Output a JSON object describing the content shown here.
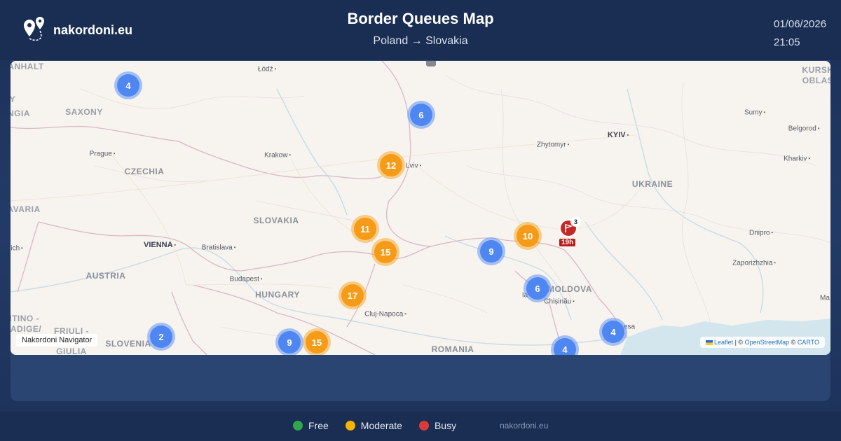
{
  "brand": {
    "name": "nakordoni.eu",
    "logo_icon": "map-pin-route-icon"
  },
  "header": {
    "title": "Border Queues Map",
    "subtitle": "Poland → Slovakia",
    "date": "01/06/2026",
    "time": "21:05"
  },
  "map": {
    "labels": {
      "anhalt": "ANHALT",
      "saxony": "SAXONY",
      "czechia": "CZECHIA",
      "slovakia": "SLOVAKIA",
      "austria": "AUSTRIA",
      "hungary": "HUNGARY",
      "slovenia": "SLOVENIA",
      "romania": "ROMANIA",
      "ukraine": "UKRAINE",
      "moldova": "MOLDOVA",
      "kursk": "KURSK",
      "oblas": "OBLAS",
      "avaria": "AVARIA",
      "ngia": "NGIA",
      "y": "Y",
      "ntino": "NTINO -",
      "adige": "ADIGE/",
      "friuli": "FRIULI -",
      "giulia": "GIULIA",
      "lodz": "Łódź",
      "prague": "Prague",
      "krakow": "Krakow",
      "lviv": "Lviv",
      "vienna": "VIENNA",
      "bratislava": "Bratislava",
      "budapest": "Budapest",
      "cluj": "Cluj-Napoca",
      "zhytomyr": "Zhytomyr",
      "kyiv": "KYIV",
      "sumy": "Sumy",
      "belgorod": "Belgorod",
      "kharkiv": "Kharkiv",
      "dnipro": "Dnipro",
      "zaporizhzhia": "Zaporizhzhia",
      "chisinau": "Chișinău",
      "iasi": "Ia",
      "odesa": "esa",
      "ich": "ich",
      "ma": "Ma"
    },
    "clusters": [
      {
        "id": "c1",
        "count": "4",
        "status": "blue"
      },
      {
        "id": "c2",
        "count": "6",
        "status": "blue"
      },
      {
        "id": "c3",
        "count": "12",
        "status": "orange"
      },
      {
        "id": "c4",
        "count": "11",
        "status": "orange"
      },
      {
        "id": "c5",
        "count": "15",
        "status": "orange"
      },
      {
        "id": "c6",
        "count": "9",
        "status": "blue"
      },
      {
        "id": "c7",
        "count": "10",
        "status": "orange"
      },
      {
        "id": "c8",
        "count": "6",
        "status": "blue"
      },
      {
        "id": "c9",
        "count": "17",
        "status": "orange"
      },
      {
        "id": "c10",
        "count": "2",
        "status": "blue"
      },
      {
        "id": "c11",
        "count": "9",
        "status": "blue"
      },
      {
        "id": "c12",
        "count": "15",
        "status": "orange"
      },
      {
        "id": "c13",
        "count": "4",
        "status": "blue"
      },
      {
        "id": "c14",
        "count": "4",
        "status": "blue"
      }
    ],
    "busy_marker": {
      "count": "3",
      "wait": "19h",
      "icon": "flag-icon"
    },
    "navigator_label": "Nakordoni Navigator",
    "attribution": {
      "leaflet": "Leaflet",
      "sep1": "| ©",
      "osm": "OpenStreetMap",
      "sep2": "©",
      "carto": "CARTO"
    },
    "colors": {
      "free": "#2ea84a",
      "moderate": "#f4b400",
      "busy": "#d93a3a",
      "cluster_blue": "#4e86f2",
      "cluster_orange": "#f59b18"
    }
  },
  "legend": {
    "free": "Free",
    "moderate": "Moderate",
    "busy": "Busy",
    "site": "nakordoni.eu"
  }
}
